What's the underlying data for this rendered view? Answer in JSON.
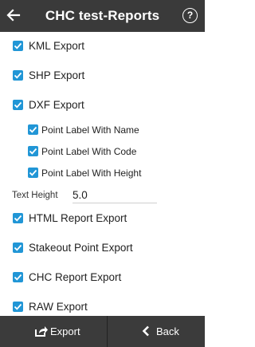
{
  "header": {
    "title": "CHC test-Reports",
    "back_icon": "back-arrow-icon",
    "help_label": "?"
  },
  "options": [
    {
      "label": "KML Export",
      "checked": true
    },
    {
      "label": "SHP Export",
      "checked": true
    },
    {
      "label": "DXF Export",
      "checked": true
    }
  ],
  "dxf_suboptions": [
    {
      "label": "Point Label With Name",
      "checked": true
    },
    {
      "label": "Point Label With Code",
      "checked": true
    },
    {
      "label": "Point Label With Height",
      "checked": true
    }
  ],
  "text_height": {
    "label": "Text Height",
    "value": "5.0"
  },
  "more_options": [
    {
      "label": "HTML Report Export",
      "checked": true
    },
    {
      "label": "Stakeout Point Export",
      "checked": true
    },
    {
      "label": "CHC Report Export",
      "checked": true
    },
    {
      "label": "RAW Export",
      "checked": true
    }
  ],
  "footer": {
    "export_label": "Export",
    "back_label": "Back"
  },
  "colors": {
    "accent": "#2196d6",
    "bar": "#3a3a3a"
  }
}
